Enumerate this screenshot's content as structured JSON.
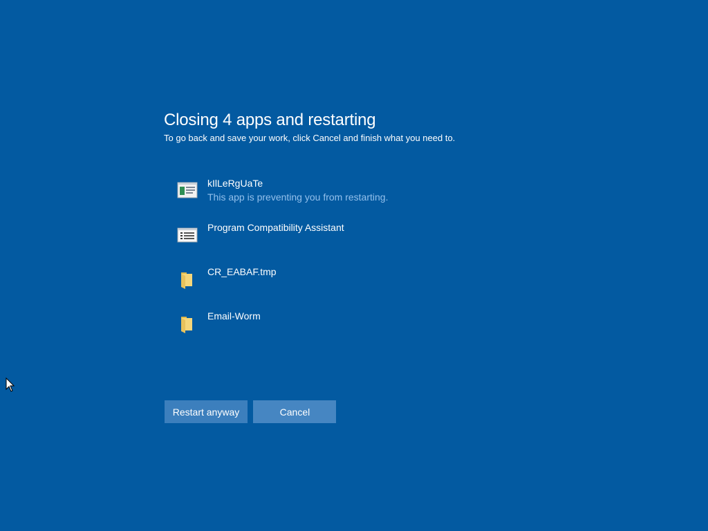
{
  "dialog": {
    "title": "Closing 4 apps and restarting",
    "subtitle": "To go back and save your work, click Cancel and finish what you need to."
  },
  "apps": [
    {
      "name": "kIlLeRgUaTe",
      "status": "This app is preventing you from restarting.",
      "icon": "window-app-icon"
    },
    {
      "name": "Program Compatibility Assistant",
      "icon": "list-app-icon"
    },
    {
      "name": "CR_EABAF.tmp",
      "icon": "folder-icon"
    },
    {
      "name": "Email-Worm",
      "icon": "folder-icon"
    }
  ],
  "buttons": {
    "restart_label": "Restart anyway",
    "cancel_label": "Cancel"
  },
  "colors": {
    "background": "#035aa1",
    "button": "#3c7fbd",
    "status_text": "#93c0ec"
  }
}
